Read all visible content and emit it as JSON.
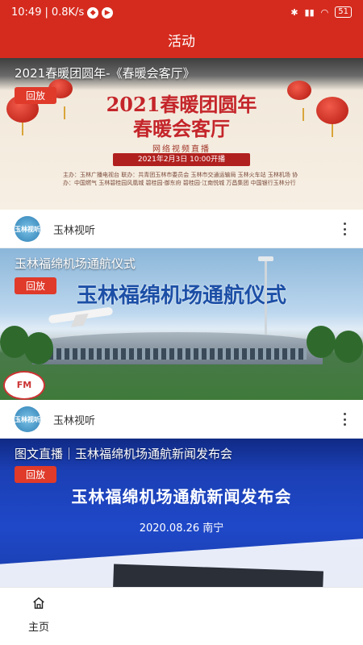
{
  "status_bar": {
    "time": "10:49",
    "speed": "0.8K/s",
    "battery": "51"
  },
  "header": {
    "title": "活动"
  },
  "cards": [
    {
      "title": "2021春暖团圆年-《春暖会客厅》",
      "badge": "回放",
      "banner": {
        "line1": "2021春暖团圆年",
        "line2": "春暖会客厅",
        "subtitle": "网络视频直播",
        "date": "2021年2月3日  10:00开播",
        "credits": "主办：玉林广播电视台  联办：共青团玉林市委员会 玉林市交通运输局 玉林火车站 玉林机场  协办：中国燃气 玉林碧桂园风凰城 碧桂园·御东府 碧桂园·江南悦城 万昌集团 中国银行玉林分行"
      },
      "source": {
        "name": "玉林视听",
        "avatar_text": "玉林视听"
      }
    },
    {
      "title": "玉林福绵机场通航仪式",
      "badge": "回放",
      "banner": {
        "headline": "玉林福绵机场通航仪式",
        "corner_logo": "FM"
      },
      "source": {
        "name": "玉林视听",
        "avatar_text": "玉林视听"
      }
    },
    {
      "title": "图文直播｜玉林福绵机场通航新闻发布会",
      "badge": "回放",
      "banner": {
        "headline": "玉林福绵机场通航新闻发布会",
        "sub": "2020.08.26 南宁"
      }
    }
  ],
  "tabbar": {
    "home_label": "主页"
  },
  "colors": {
    "brand_red": "#d52b1e",
    "badge_red": "#e03a2a"
  }
}
